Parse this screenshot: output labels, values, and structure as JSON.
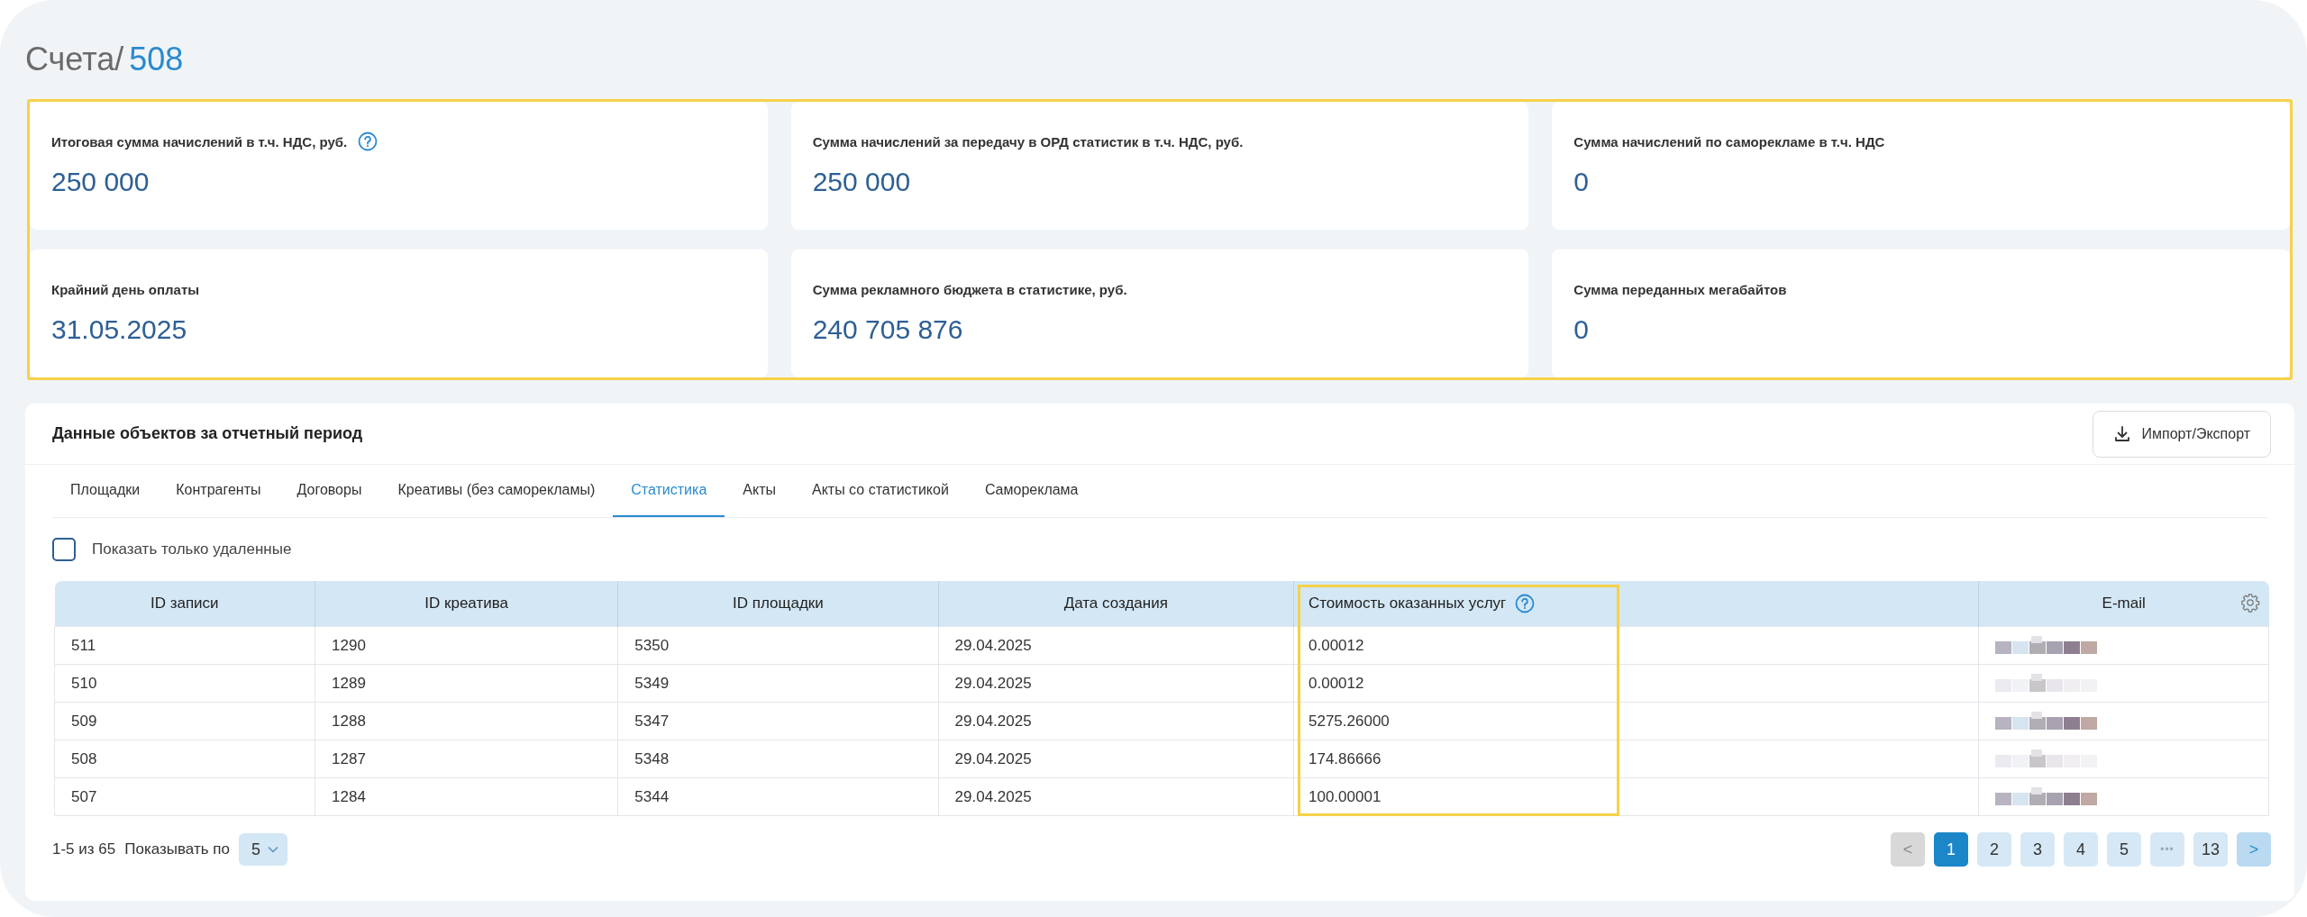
{
  "breadcrumb": {
    "section": "Счета/",
    "current": "508"
  },
  "summary_cards": [
    {
      "label": "Итоговая сумма начислений в т.ч. НДС, руб.",
      "value": "250 000",
      "help": true
    },
    {
      "label": "Сумма начислений за передачу в ОРД статистик в т.ч. НДС, руб.",
      "value": "250 000",
      "help": false
    },
    {
      "label": "Сумма начислений по саморекламе в т.ч. НДС",
      "value": "0",
      "help": false
    },
    {
      "label": "Крайний день оплаты",
      "value": "31.05.2025",
      "help": false
    },
    {
      "label": "Сумма рекламного бюджета в статистике, руб.",
      "value": "240 705 876",
      "help": false
    },
    {
      "label": "Сумма переданных мегабайтов",
      "value": "0",
      "help": false
    }
  ],
  "panel": {
    "title": "Данные объектов за отчетный период",
    "export_button": "Импорт/Экспорт"
  },
  "tabs": [
    {
      "label": "Площадки",
      "selected": false
    },
    {
      "label": "Контрагенты",
      "selected": false
    },
    {
      "label": "Договоры",
      "selected": false
    },
    {
      "label": "Креативы (без саморекламы)",
      "selected": false
    },
    {
      "label": "Статистика",
      "selected": true
    },
    {
      "label": "Акты",
      "selected": false
    },
    {
      "label": "Акты со статистикой",
      "selected": false
    },
    {
      "label": "Самореклама",
      "selected": false
    }
  ],
  "deleted_filter": {
    "label": "Показать только удаленные",
    "checked": false
  },
  "table": {
    "columns": [
      {
        "label": "ID записи",
        "help": false
      },
      {
        "label": "ID креатива",
        "help": false
      },
      {
        "label": "ID площадки",
        "help": false
      },
      {
        "label": "Дата создания",
        "help": false
      },
      {
        "label": "Стоимость оказанных услуг",
        "help": true
      },
      {
        "label": "E-mail",
        "help": false
      }
    ],
    "rows": [
      [
        "511",
        "1290",
        "5350",
        "29.04.2025",
        "0.00012"
      ],
      [
        "510",
        "1289",
        "5349",
        "29.04.2025",
        "0.00012"
      ],
      [
        "509",
        "1288",
        "5347",
        "29.04.2025",
        "5275.26000"
      ],
      [
        "508",
        "1287",
        "5348",
        "29.04.2025",
        "174.86666"
      ],
      [
        "507",
        "1284",
        "5344",
        "29.04.2025",
        "100.00001"
      ]
    ]
  },
  "pagination": {
    "range": "1-5 из 65",
    "per_page_label": "Показывать по",
    "per_page": "5",
    "pages": [
      {
        "kind": "prev",
        "label": "<",
        "disabled": true,
        "selected": false
      },
      {
        "kind": "page",
        "label": "1",
        "disabled": false,
        "selected": true
      },
      {
        "kind": "page",
        "label": "2",
        "disabled": false,
        "selected": false
      },
      {
        "kind": "page",
        "label": "3",
        "disabled": false,
        "selected": false
      },
      {
        "kind": "page",
        "label": "4",
        "disabled": false,
        "selected": false
      },
      {
        "kind": "page",
        "label": "5",
        "disabled": false,
        "selected": false
      },
      {
        "kind": "ellipsis",
        "label": "•••",
        "disabled": false,
        "selected": false
      },
      {
        "kind": "page",
        "label": "13",
        "disabled": false,
        "selected": false
      },
      {
        "kind": "next",
        "label": ">",
        "disabled": false,
        "selected": false
      }
    ]
  }
}
